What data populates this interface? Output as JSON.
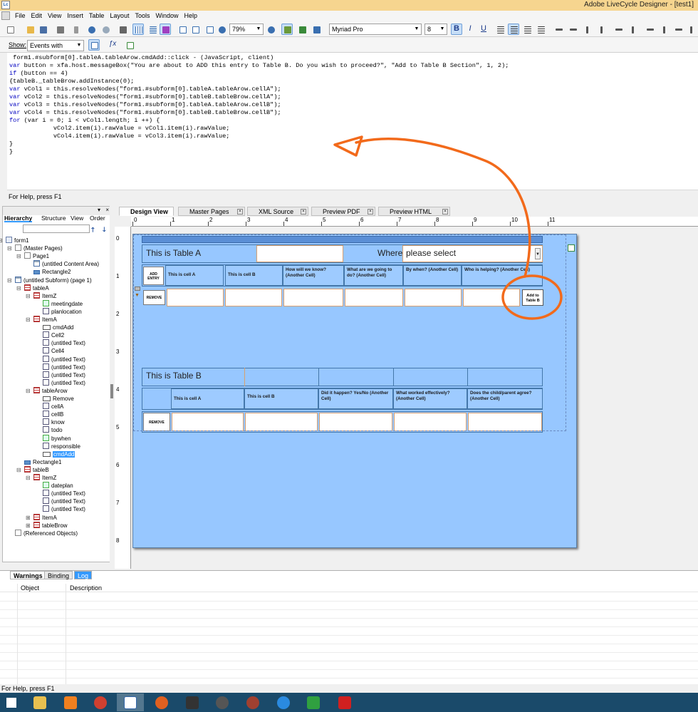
{
  "window": {
    "title": "Adobe LiveCycle Designer - [test1]",
    "app_icon": "Lc"
  },
  "menu": [
    "File",
    "Edit",
    "View",
    "Insert",
    "Table",
    "Layout",
    "Tools",
    "Window",
    "Help"
  ],
  "toolbar": {
    "zoom": "79%",
    "font": "Myriad Pro",
    "font_size": "8",
    "bold": "B",
    "italic": "I",
    "underline": "U"
  },
  "script_bar": {
    "show_label": "Show:",
    "show_value": "Events with Scripts"
  },
  "script_lines": [
    " form1.#subform[0].tableA.tableArow.cmdAdd::click - (JavaScript, client)",
    "var button = xfa.host.messageBox(\"You are about to ADD this entry to Table B. Do you wish to proceed?\", \"Add to Table B Section\", 1, 2);",
    "if (button == 4)",
    "{tableB._tableBrow.addInstance(0);",
    "var vCol1 = this.resolveNodes(\"form1.#subform[0].tableA.tableArow.cellA\");",
    "var vCol2 = this.resolveNodes(\"form1.#subform[0].tableB.tableBrow.cellA\");",
    "var vCol3 = this.resolveNodes(\"form1.#subform[0].tableA.tableArow.cellB\");",
    "var vCol4 = this.resolveNodes(\"form1.#subform[0].tableB.tableBrow.cellB\");",
    "for (var i = 0; i < vCol1.length; i ++) {",
    "            vCol2.item(i).rawValue = vCol1.item(i).rawValue;",
    "            vCol4.item(i).rawValue = vCol3.item(i).rawValue;",
    "}",
    "}"
  ],
  "script_status": "For Help, press F1",
  "left_tabs": [
    "Hierarchy",
    "Structure",
    "View",
    "Order"
  ],
  "hierarchy": [
    {
      "label": "form1",
      "icon": "form",
      "depth": 0,
      "toggle": "-"
    },
    {
      "label": "(Master Pages)",
      "icon": "page",
      "depth": 1,
      "toggle": "-"
    },
    {
      "label": "Page1",
      "icon": "page",
      "depth": 2,
      "toggle": "-"
    },
    {
      "label": "(untitled Content Area)",
      "icon": "sub",
      "depth": 3,
      "toggle": ""
    },
    {
      "label": "Rectangle2",
      "icon": "rect",
      "depth": 3,
      "toggle": ""
    },
    {
      "label": "(untitled Subform) (page 1)",
      "icon": "sub",
      "depth": 1,
      "toggle": "-"
    },
    {
      "label": "tableA",
      "icon": "tbl",
      "depth": 2,
      "toggle": "-"
    },
    {
      "label": "ItemZ",
      "icon": "tbl",
      "depth": 3,
      "toggle": "-"
    },
    {
      "label": "meetingdate",
      "icon": "date",
      "depth": 4,
      "toggle": ""
    },
    {
      "label": "planlocation",
      "icon": "fld",
      "depth": 4,
      "toggle": ""
    },
    {
      "label": "ItemA",
      "icon": "tbl",
      "depth": 3,
      "toggle": "-"
    },
    {
      "label": "cmdAdd",
      "icon": "btn",
      "depth": 4,
      "toggle": ""
    },
    {
      "label": "Cell2",
      "icon": "txt",
      "depth": 4,
      "toggle": ""
    },
    {
      "label": "(untitled Text)",
      "icon": "txt",
      "depth": 4,
      "toggle": ""
    },
    {
      "label": "Cell4",
      "icon": "txt",
      "depth": 4,
      "toggle": ""
    },
    {
      "label": "(untitled Text)",
      "icon": "txt",
      "depth": 4,
      "toggle": ""
    },
    {
      "label": "(untitled Text)",
      "icon": "txt",
      "depth": 4,
      "toggle": ""
    },
    {
      "label": "(untitled Text)",
      "icon": "txt",
      "depth": 4,
      "toggle": ""
    },
    {
      "label": "(untitled Text)",
      "icon": "txt",
      "depth": 4,
      "toggle": ""
    },
    {
      "label": "tableArow",
      "icon": "tbl",
      "depth": 3,
      "toggle": "-"
    },
    {
      "label": "Remove",
      "icon": "btn",
      "depth": 4,
      "toggle": ""
    },
    {
      "label": "cellA",
      "icon": "fld",
      "depth": 4,
      "toggle": ""
    },
    {
      "label": "cellB",
      "icon": "fld",
      "depth": 4,
      "toggle": ""
    },
    {
      "label": "know",
      "icon": "fld",
      "depth": 4,
      "toggle": ""
    },
    {
      "label": "todo",
      "icon": "fld",
      "depth": 4,
      "toggle": ""
    },
    {
      "label": "bywhen",
      "icon": "date",
      "depth": 4,
      "toggle": ""
    },
    {
      "label": "responsible",
      "icon": "fld",
      "depth": 4,
      "toggle": ""
    },
    {
      "label": "cmdAdd",
      "icon": "btn",
      "depth": 4,
      "toggle": "",
      "selected": true
    },
    {
      "label": "Rectangle1",
      "icon": "rect",
      "depth": 2,
      "toggle": ""
    },
    {
      "label": "tableB",
      "icon": "tbl",
      "depth": 2,
      "toggle": "-"
    },
    {
      "label": "ItemZ",
      "icon": "tbl",
      "depth": 3,
      "toggle": "-"
    },
    {
      "label": "dateplan",
      "icon": "date",
      "depth": 4,
      "toggle": ""
    },
    {
      "label": "(untitled Text)",
      "icon": "txt",
      "depth": 4,
      "toggle": ""
    },
    {
      "label": "(untitled Text)",
      "icon": "txt",
      "depth": 4,
      "toggle": ""
    },
    {
      "label": "(untitled Text)",
      "icon": "txt",
      "depth": 4,
      "toggle": ""
    },
    {
      "label": "ItemA",
      "icon": "tbl",
      "depth": 3,
      "toggle": "+"
    },
    {
      "label": "tableBrow",
      "icon": "tbl",
      "depth": 3,
      "toggle": "+"
    },
    {
      "label": "(Referenced Objects)",
      "icon": "page",
      "depth": 1,
      "toggle": ""
    }
  ],
  "doc_tabs": [
    "Design View",
    "Master Pages",
    "XML Source",
    "Preview PDF",
    "Preview HTML"
  ],
  "ruler_h": [
    "0",
    "1",
    "2",
    "3",
    "4",
    "5",
    "6",
    "7",
    "8",
    "9",
    "10",
    "11"
  ],
  "ruler_v": [
    "0",
    "1",
    "2",
    "3",
    "4",
    "5",
    "6",
    "7",
    "8"
  ],
  "tableA": {
    "title": "This is Table A",
    "where_label": "Where:",
    "where_value": "please select",
    "add_entry": "ADD ENTRY",
    "remove": "REMOVE",
    "add_to_b": "Add to Table B",
    "headers": [
      "This is cell A",
      "This is cell B",
      "How will we know? (Another Cell)",
      "What are we going to do? (Another Cell)",
      "By when? (Another Cell)",
      "Who is helping? (Another Cell)"
    ]
  },
  "tableB": {
    "title": "This is Table B",
    "remove": "REMOVE",
    "headers": [
      "This is cell A",
      "This is cell B",
      "Did it happen? Yes/No (Another Cell)",
      "What worked effectively? (Another Cell)",
      "Does the child/parent agree? (Another Cell)"
    ]
  },
  "bottom_tabs": [
    "Warnings",
    "Binding",
    "Log"
  ],
  "bottom_columns": [
    "Object",
    "Description"
  ],
  "status": "For Help, press F1",
  "colors": {
    "titlebar": "#f6d58f",
    "page_blue": "#97c7ff",
    "annotation_orange": "#f26a1b",
    "taskbar": "#1a4a6a"
  }
}
